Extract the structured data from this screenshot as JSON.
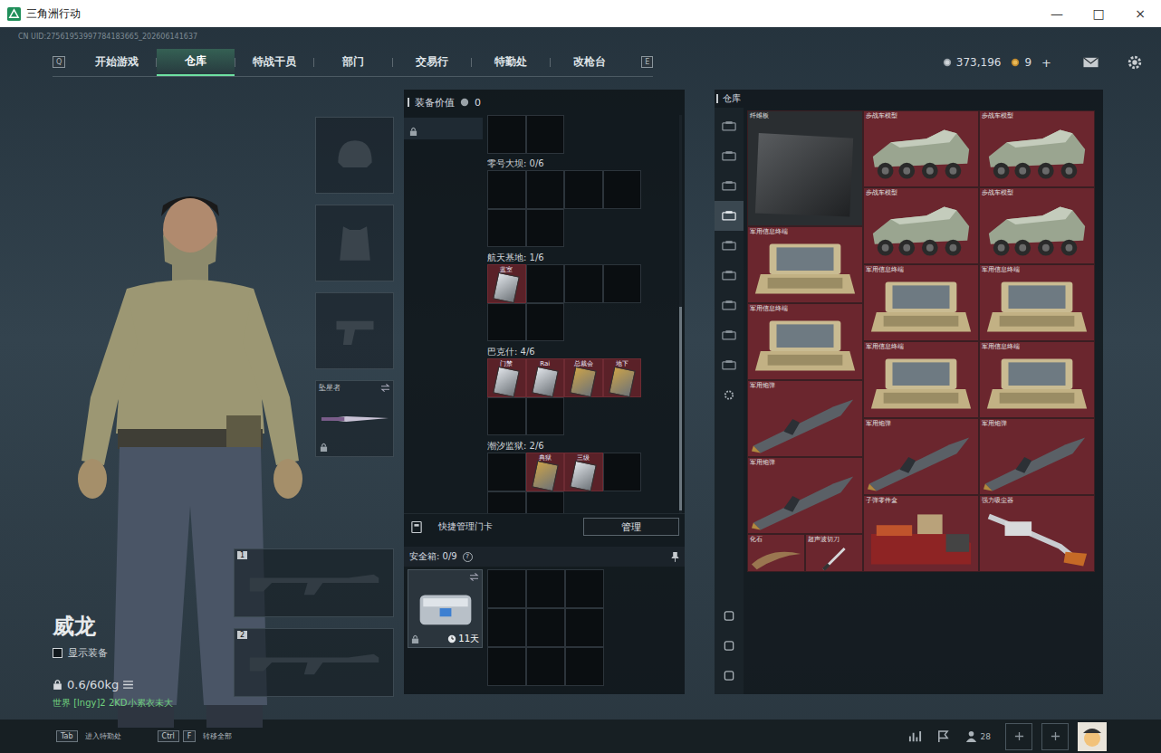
{
  "window": {
    "title": "三角洲行动",
    "controls": [
      "—",
      "□",
      "×"
    ]
  },
  "uid": "CN UID:27561953997784183665_202606141637",
  "nav": {
    "prev_key": "Q",
    "next_key": "E",
    "tabs": [
      {
        "label": "开始游戏",
        "selected": false
      },
      {
        "label": "仓库",
        "selected": true
      },
      {
        "label": "特战干员",
        "selected": false
      },
      {
        "label": "部门",
        "selected": false
      },
      {
        "label": "交易行",
        "selected": false
      },
      {
        "label": "特勤处",
        "selected": false
      },
      {
        "label": "改枪台",
        "selected": false
      }
    ]
  },
  "currency": {
    "coins": "373,196",
    "tickets": "9",
    "add": "+"
  },
  "operator": {
    "name": "威龙",
    "show_gear": {
      "label": "显示装备",
      "checked": false
    },
    "weight": "0.6/60kg",
    "player": "世界 [lngy]2 2KD小累衣未大"
  },
  "slots": [
    {
      "kind": "helmet",
      "name": ""
    },
    {
      "kind": "armor",
      "name": ""
    },
    {
      "kind": "pistol",
      "name": ""
    },
    {
      "kind": "melee",
      "name": "坠星者"
    }
  ],
  "weapons": [
    {
      "number": "1"
    },
    {
      "number": "2"
    }
  ],
  "loadout": {
    "value_label": "装备价值",
    "value": "0",
    "sidebar": [
      {
        "selected": true
      }
    ],
    "key_sections": [
      {
        "title": "零号大坝: 0/6",
        "slots": [
          null,
          null,
          null,
          null,
          null,
          null
        ]
      },
      {
        "title": "航天基地: 1/6",
        "slots": [
          {
            "label": "蓝室",
            "color": "#dfe3e8"
          },
          null,
          null,
          null,
          null,
          null
        ]
      },
      {
        "title": "巴克什: 4/6",
        "slots": [
          {
            "label": "门禁",
            "color": "#dfe3e8"
          },
          {
            "label": "Rai",
            "color": "#dfe3e8"
          },
          {
            "label": "总裁会",
            "color": "#caa24a"
          },
          {
            "label": "地下",
            "color": "#caa24a"
          },
          null,
          null
        ]
      },
      {
        "title": "潮汐监狱: 2/6",
        "slots": [
          null,
          {
            "label": "典狱",
            "color": "#caa24a"
          },
          {
            "label": "三级",
            "color": "#dfe3e8"
          },
          null,
          null,
          null
        ]
      }
    ],
    "manage_label": "快捷管理门卡",
    "manage_button": "管理",
    "safebox": {
      "label": "安全箱: 0/9",
      "help": "?",
      "timer": "11天"
    }
  },
  "warehouse": {
    "title": "仓库",
    "tabs": [
      {
        "kind": "category",
        "selected": false
      },
      {
        "kind": "category",
        "selected": false
      },
      {
        "kind": "category",
        "selected": false
      },
      {
        "kind": "category",
        "selected": true
      },
      {
        "kind": "category",
        "selected": false
      },
      {
        "kind": "category",
        "selected": false
      },
      {
        "kind": "category",
        "selected": false
      },
      {
        "kind": "category",
        "selected": false
      },
      {
        "kind": "category",
        "selected": false
      },
      {
        "kind": "settings",
        "selected": false
      }
    ],
    "tools": [
      {
        "kind": "tool"
      },
      {
        "kind": "tool"
      },
      {
        "kind": "tool"
      }
    ],
    "items": [
      {
        "name": "纤维板",
        "kind": "board"
      },
      {
        "name": "步战车模型",
        "kind": "vehicle"
      },
      {
        "name": "步战车模型",
        "kind": "vehicle"
      },
      {
        "name": "步战车模型",
        "kind": "vehicle"
      },
      {
        "name": "步战车模型",
        "kind": "vehicle"
      },
      {
        "name": "军用信息终端",
        "kind": "terminal"
      },
      {
        "name": "军用信息终端",
        "kind": "terminal"
      },
      {
        "name": "军用信息终端",
        "kind": "terminal"
      },
      {
        "name": "军用信息终端",
        "kind": "terminal"
      },
      {
        "name": "军用信息终端",
        "kind": "terminal"
      },
      {
        "name": "军用信息终端",
        "kind": "terminal"
      },
      {
        "name": "军用炮弹",
        "kind": "shell"
      },
      {
        "name": "军用炮弹",
        "kind": "shell"
      },
      {
        "name": "军用炮弹",
        "kind": "shell"
      },
      {
        "name": "军用炮弹",
        "kind": "shell"
      },
      {
        "name": "子弹零件盒",
        "kind": "box"
      },
      {
        "name": "强力吸尘器",
        "kind": "vacuum"
      },
      {
        "name": "化石",
        "kind": "fossil"
      },
      {
        "name": "超声波切刀",
        "kind": "cutter"
      }
    ]
  },
  "bottom_bar": {
    "hints": [
      {
        "keys": [
          "Tab"
        ],
        "label": "进入特勤处"
      },
      {
        "keys": [
          "Ctrl",
          "F"
        ],
        "label": "转移全部"
      }
    ],
    "friends": "28"
  }
}
